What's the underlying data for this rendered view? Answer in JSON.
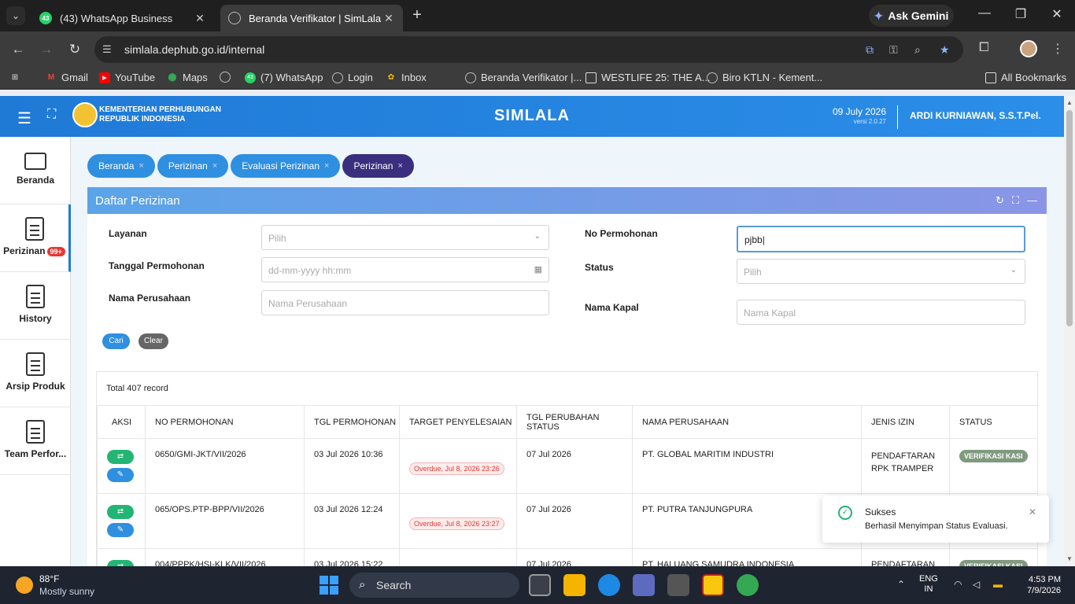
{
  "browser": {
    "tabs": [
      {
        "title": "(43) WhatsApp Business",
        "badge": "43",
        "active": false
      },
      {
        "title": "Beranda Verifikator | SimLala",
        "active": true
      }
    ],
    "gemini_label": "Ask Gemini",
    "url": "simlala.dephub.go.id/internal",
    "bookmarks": [
      {
        "label": "Gmail",
        "icon": "gmail-icon"
      },
      {
        "label": "YouTube",
        "icon": "youtube-icon"
      },
      {
        "label": "Maps",
        "icon": "maps-icon"
      },
      {
        "label": "",
        "icon": "globe-icon"
      },
      {
        "label": "(7) WhatsApp",
        "icon": "whatsapp-icon",
        "badge": "43"
      },
      {
        "label": "Login",
        "icon": "globe-icon"
      },
      {
        "label": "Inbox",
        "icon": "photos-icon"
      },
      {
        "label": "Beranda Verifikator |...",
        "icon": "globe-icon"
      },
      {
        "label": "WESTLIFE 25: THE A...",
        "icon": "page-icon"
      },
      {
        "label": "Biro KTLN - Kement...",
        "icon": "globe-icon"
      }
    ],
    "all_bookmarks": "All Bookmarks"
  },
  "app": {
    "ministry_line1": "KEMENTERIAN PERHUBUNGAN",
    "ministry_line2": "REPUBLIK INDONESIA",
    "title": "SIMLALA",
    "date": "09 July 2026",
    "version": "versi 2.0.27",
    "user": "ARDI KURNIAWAN, S.S.T.Pel.",
    "brand_color": "#1f7ad6"
  },
  "sidebar": {
    "items": [
      {
        "label": "Beranda",
        "icon": "monitor-icon"
      },
      {
        "label": "Perizinan",
        "icon": "document-icon",
        "badge": "99+"
      },
      {
        "label": "History",
        "icon": "document-icon"
      },
      {
        "label": "Arsip Produk",
        "icon": "document-icon"
      },
      {
        "label": "Team Perfor...",
        "icon": "document-icon"
      }
    ]
  },
  "breadcrumbs": [
    "Beranda",
    "Perizinan",
    "Evaluasi Perizinan",
    "Perizinan"
  ],
  "panel": {
    "title": "Daftar Perizinan"
  },
  "filters": {
    "layanan_label": "Layanan",
    "layanan_placeholder": "Pilih",
    "tanggal_label": "Tanggal Permohonan",
    "tanggal_placeholder": "dd-mm-yyyy hh:mm",
    "nama_perusahaan_label": "Nama Perusahaan",
    "nama_perusahaan_placeholder": "Nama Perusahaan",
    "no_permohonan_label": "No Permohonan",
    "no_permohonan_value": "pjbb",
    "status_label": "Status",
    "status_placeholder": "Pilih",
    "nama_kapal_label": "Nama Kapal",
    "nama_kapal_placeholder": "Nama Kapal",
    "cari": "Cari",
    "clear": "Clear"
  },
  "table": {
    "total": "Total 407 record",
    "headers": [
      "AKSI",
      "NO PERMOHONAN",
      "TGL PERMOHONAN",
      "TARGET PENYELESAIAN",
      "TGL PERUBAHAN STATUS",
      "NAMA PERUSAHAAN",
      "JENIS IZIN",
      "STATUS"
    ],
    "rows": [
      {
        "no": "0650/GMI-JKT/VII/2026",
        "tgl": "03 Jul 2026 10:36",
        "target": "Overdue, Jul 8, 2026 23:26",
        "tgl_status": "07 Jul 2026",
        "perusahaan": "PT. GLOBAL MARITIM INDUSTRI",
        "jenis": "PENDAFTARAN RPK TRAMPER",
        "status": "VERIFIKASI KASI"
      },
      {
        "no": "065/OPS.PTP-BPP/VII/2026",
        "tgl": "03 Jul 2026 12:24",
        "target": "Overdue, Jul 8, 2026 23:27",
        "tgl_status": "07 Jul 2026",
        "perusahaan": "PT. PUTRA TANJUNGPURA",
        "jenis": "",
        "status": ""
      },
      {
        "no": "004/PPPK/HSI-KLK/VII/2026",
        "tgl": "03 Jul 2026 15:22",
        "target": "",
        "tgl_status": "07 Jul 2026",
        "perusahaan": "PT. HALUANG SAMUDRA INDONESIA",
        "jenis": "PENDAFTARAN",
        "status": "VERIFIKASI KASI"
      }
    ]
  },
  "toast": {
    "title": "Sukses",
    "message": "Berhasil Menyimpan Status Evaluasi."
  },
  "taskbar": {
    "temp": "88°F",
    "condition": "Mostly sunny",
    "search": "Search",
    "lang1": "ENG",
    "lang2": "IN",
    "time": "4:53 PM",
    "date": "7/9/2026"
  }
}
